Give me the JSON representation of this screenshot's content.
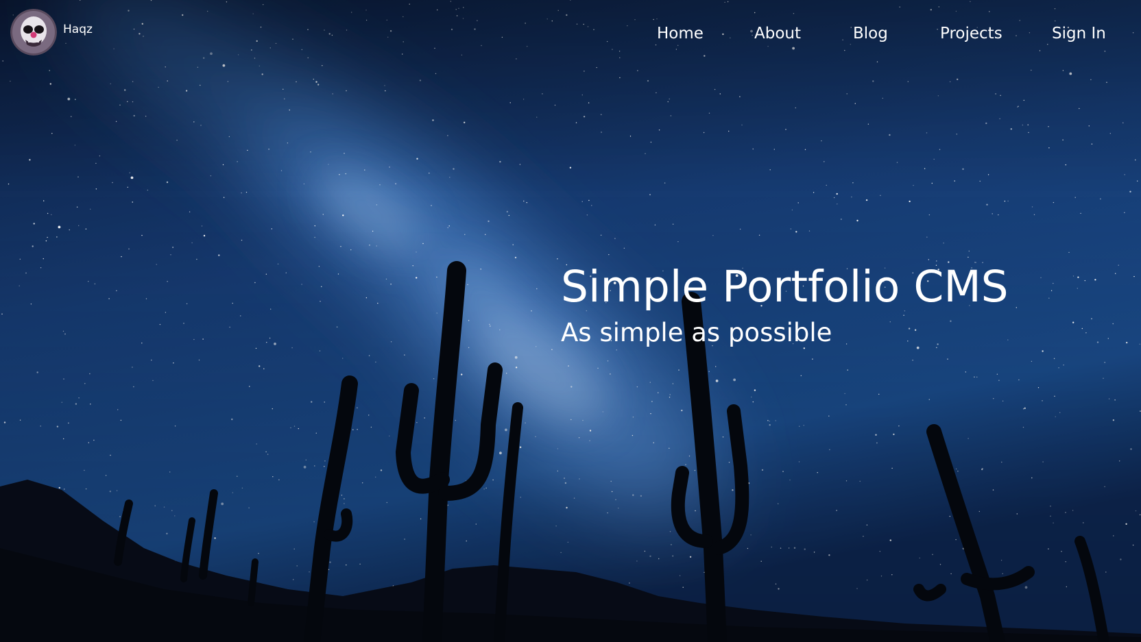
{
  "site": {
    "brand_name": "Haqz",
    "avatar_icon": "skull-clown-avatar"
  },
  "nav": {
    "items": [
      {
        "label": "Home"
      },
      {
        "label": "About"
      },
      {
        "label": "Blog"
      },
      {
        "label": "Projects"
      },
      {
        "label": "Sign In"
      }
    ]
  },
  "hero": {
    "title": "Simple Portfolio CMS",
    "subtitle": "As simple as possible",
    "background": "night-sky-milky-way-saguaro-cacti-photo"
  },
  "colors": {
    "sky_top": "#0c1d3f",
    "sky_mid": "#1c4a86",
    "milky_way": "#6fa3e0",
    "silhouette": "#05080f",
    "text": "#ffffff"
  }
}
